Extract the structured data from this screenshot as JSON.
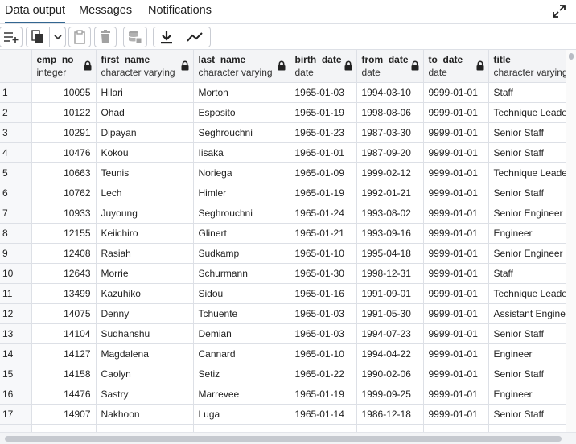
{
  "tabs": [
    {
      "label": "Data output"
    },
    {
      "label": "Messages"
    },
    {
      "label": "Notifications"
    }
  ],
  "toolbar": {
    "icons": [
      "add-row-icon",
      "copy-icon",
      "chevron-down-icon",
      "paste-icon",
      "delete-icon",
      "save-data-icon",
      "download-icon",
      "graph-icon"
    ]
  },
  "columns": [
    {
      "name": "emp_no",
      "type": "integer"
    },
    {
      "name": "first_name",
      "type": "character varying"
    },
    {
      "name": "last_name",
      "type": "character varying"
    },
    {
      "name": "birth_date",
      "type": "date"
    },
    {
      "name": "from_date",
      "type": "date"
    },
    {
      "name": "to_date",
      "type": "date"
    },
    {
      "name": "title",
      "type": "character varying"
    }
  ],
  "rows": [
    {
      "n": "1",
      "emp_no": "10095",
      "first_name": "Hilari",
      "last_name": "Morton",
      "birth_date": "1965-01-03",
      "from_date": "1994-03-10",
      "to_date": "9999-01-01",
      "title": "Staff"
    },
    {
      "n": "2",
      "emp_no": "10122",
      "first_name": "Ohad",
      "last_name": "Esposito",
      "birth_date": "1965-01-19",
      "from_date": "1998-08-06",
      "to_date": "9999-01-01",
      "title": "Technique Leader"
    },
    {
      "n": "3",
      "emp_no": "10291",
      "first_name": "Dipayan",
      "last_name": "Seghrouchni",
      "birth_date": "1965-01-23",
      "from_date": "1987-03-30",
      "to_date": "9999-01-01",
      "title": "Senior Staff"
    },
    {
      "n": "4",
      "emp_no": "10476",
      "first_name": "Kokou",
      "last_name": "Iisaka",
      "birth_date": "1965-01-01",
      "from_date": "1987-09-20",
      "to_date": "9999-01-01",
      "title": "Senior Staff"
    },
    {
      "n": "5",
      "emp_no": "10663",
      "first_name": "Teunis",
      "last_name": "Noriega",
      "birth_date": "1965-01-09",
      "from_date": "1999-02-12",
      "to_date": "9999-01-01",
      "title": "Technique Leader"
    },
    {
      "n": "6",
      "emp_no": "10762",
      "first_name": "Lech",
      "last_name": "Himler",
      "birth_date": "1965-01-19",
      "from_date": "1992-01-21",
      "to_date": "9999-01-01",
      "title": "Senior Staff"
    },
    {
      "n": "7",
      "emp_no": "10933",
      "first_name": "Juyoung",
      "last_name": "Seghrouchni",
      "birth_date": "1965-01-24",
      "from_date": "1993-08-02",
      "to_date": "9999-01-01",
      "title": "Senior Engineer"
    },
    {
      "n": "8",
      "emp_no": "12155",
      "first_name": "Keiichiro",
      "last_name": "Glinert",
      "birth_date": "1965-01-21",
      "from_date": "1993-09-16",
      "to_date": "9999-01-01",
      "title": "Engineer"
    },
    {
      "n": "9",
      "emp_no": "12408",
      "first_name": "Rasiah",
      "last_name": "Sudkamp",
      "birth_date": "1965-01-10",
      "from_date": "1995-04-18",
      "to_date": "9999-01-01",
      "title": "Senior Engineer"
    },
    {
      "n": "10",
      "emp_no": "12643",
      "first_name": "Morrie",
      "last_name": "Schurmann",
      "birth_date": "1965-01-30",
      "from_date": "1998-12-31",
      "to_date": "9999-01-01",
      "title": "Staff"
    },
    {
      "n": "11",
      "emp_no": "13499",
      "first_name": "Kazuhiko",
      "last_name": "Sidou",
      "birth_date": "1965-01-16",
      "from_date": "1991-09-01",
      "to_date": "9999-01-01",
      "title": "Technique Leader"
    },
    {
      "n": "12",
      "emp_no": "14075",
      "first_name": "Denny",
      "last_name": "Tchuente",
      "birth_date": "1965-01-03",
      "from_date": "1991-05-30",
      "to_date": "9999-01-01",
      "title": "Assistant Engineer"
    },
    {
      "n": "13",
      "emp_no": "14104",
      "first_name": "Sudhanshu",
      "last_name": "Demian",
      "birth_date": "1965-01-03",
      "from_date": "1994-07-23",
      "to_date": "9999-01-01",
      "title": "Senior Staff"
    },
    {
      "n": "14",
      "emp_no": "14127",
      "first_name": "Magdalena",
      "last_name": "Cannard",
      "birth_date": "1965-01-10",
      "from_date": "1994-04-22",
      "to_date": "9999-01-01",
      "title": "Engineer"
    },
    {
      "n": "15",
      "emp_no": "14158",
      "first_name": "Caolyn",
      "last_name": "Setiz",
      "birth_date": "1965-01-22",
      "from_date": "1990-02-06",
      "to_date": "9999-01-01",
      "title": "Senior Staff"
    },
    {
      "n": "16",
      "emp_no": "14476",
      "first_name": "Sastry",
      "last_name": "Marrevee",
      "birth_date": "1965-01-19",
      "from_date": "1999-09-25",
      "to_date": "9999-01-01",
      "title": "Engineer"
    },
    {
      "n": "17",
      "emp_no": "14907",
      "first_name": "Nakhoon",
      "last_name": "Luga",
      "birth_date": "1965-01-14",
      "from_date": "1986-12-18",
      "to_date": "9999-01-01",
      "title": "Senior Staff"
    },
    {
      "n": "",
      "emp_no": "",
      "first_name": "",
      "last_name": "",
      "birth_date": "",
      "from_date": "",
      "to_date": "",
      "title": ""
    }
  ]
}
